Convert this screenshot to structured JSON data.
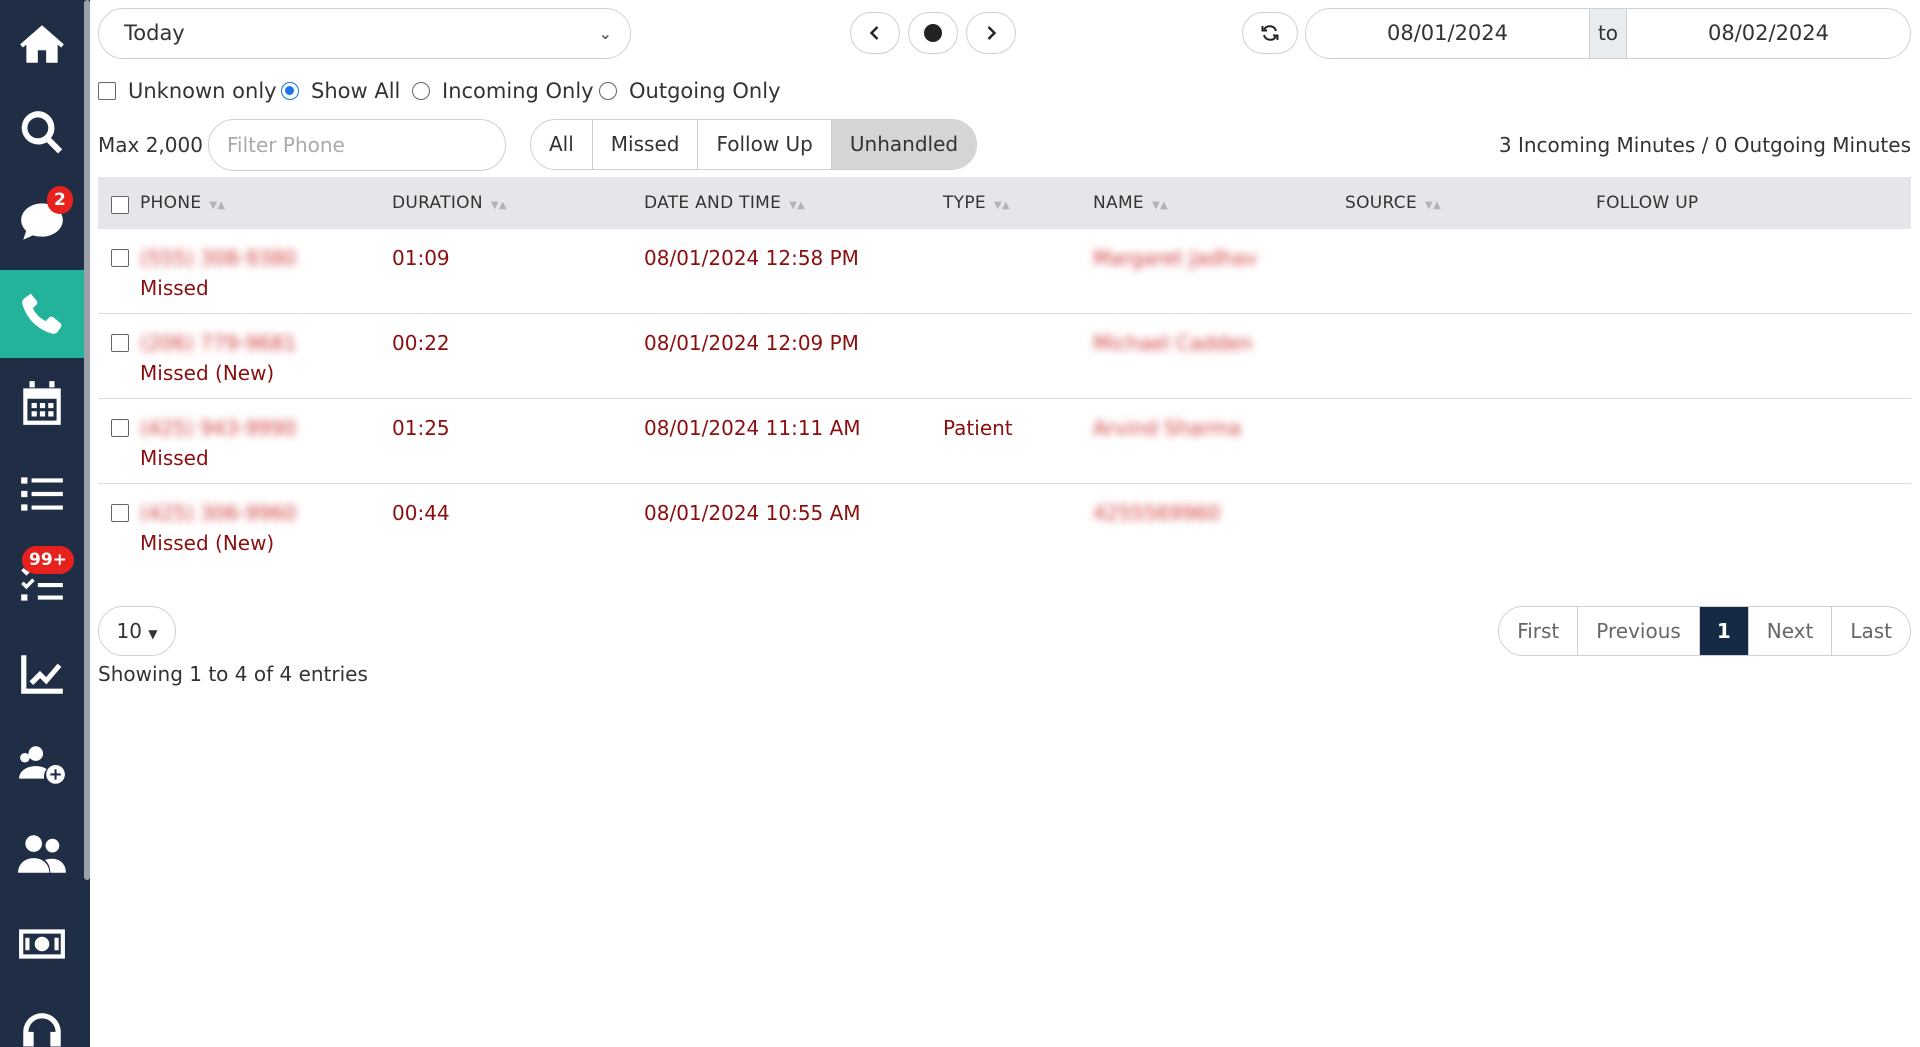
{
  "sidebar": {
    "items": [
      {
        "icon": "home-icon",
        "active": false
      },
      {
        "icon": "search-icon",
        "active": false
      },
      {
        "icon": "chat-icon",
        "active": false,
        "badge": "2"
      },
      {
        "icon": "phone-icon",
        "active": true
      },
      {
        "icon": "calendar-icon",
        "active": false
      },
      {
        "icon": "list-icon",
        "active": false
      },
      {
        "icon": "checklist-icon",
        "active": false,
        "badge": "99+"
      },
      {
        "icon": "chart-line-icon",
        "active": false
      },
      {
        "icon": "user-plus-icon",
        "active": false
      },
      {
        "icon": "users-icon",
        "active": false
      },
      {
        "icon": "money-icon",
        "active": false
      },
      {
        "icon": "headset-icon",
        "active": false
      }
    ],
    "colors": {
      "background": "#1f2d45",
      "active": "#22b39a",
      "badge": "#e6211e"
    }
  },
  "toolbar": {
    "range_select": "Today",
    "date_from": "08/01/2024",
    "date_to_label": "to",
    "date_to": "08/02/2024"
  },
  "filters": {
    "unknown_only": "Unknown only",
    "show_all": "Show All",
    "incoming_only": "Incoming Only",
    "outgoing_only": "Outgoing Only",
    "selected": "Show All"
  },
  "search": {
    "max_label": "Max 2,000",
    "phone_placeholder": "Filter Phone",
    "segments": [
      "All",
      "Missed",
      "Follow Up",
      "Unhandled"
    ],
    "active_segment": "Unhandled",
    "minutes_summary": "3 Incoming Minutes / 0 Outgoing Minutes"
  },
  "table": {
    "headers": {
      "phone": "PHONE",
      "duration": "DURATION",
      "datetime": "DATE AND TIME",
      "type": "TYPE",
      "name": "NAME",
      "source": "SOURCE",
      "follow_up": "FOLLOW UP"
    },
    "rows": [
      {
        "phone": "(555) 308-9380",
        "status": "Missed",
        "duration": "01:09",
        "datetime": "08/01/2024 12:58 PM",
        "type": "",
        "name": "Margaret Jadhav"
      },
      {
        "phone": "(206) 779-9681",
        "status": "Missed (New)",
        "duration": "00:22",
        "datetime": "08/01/2024 12:09 PM",
        "type": "",
        "name": "Michael Cadden"
      },
      {
        "phone": "(425) 943-9990",
        "status": "Missed",
        "duration": "01:25",
        "datetime": "08/01/2024 11:11 AM",
        "type": "Patient",
        "name": "Arvind Sharma"
      },
      {
        "phone": "(425) 306-9960",
        "status": "Missed (New)",
        "duration": "00:44",
        "datetime": "08/01/2024 10:55 AM",
        "type": "",
        "name": "4255569960"
      }
    ],
    "text_color": "#8b0f0f"
  },
  "footer": {
    "page_size": "10",
    "showing": "Showing 1 to 4 of 4 entries",
    "pager": {
      "first": "First",
      "previous": "Previous",
      "current": "1",
      "next": "Next",
      "last": "Last"
    }
  }
}
